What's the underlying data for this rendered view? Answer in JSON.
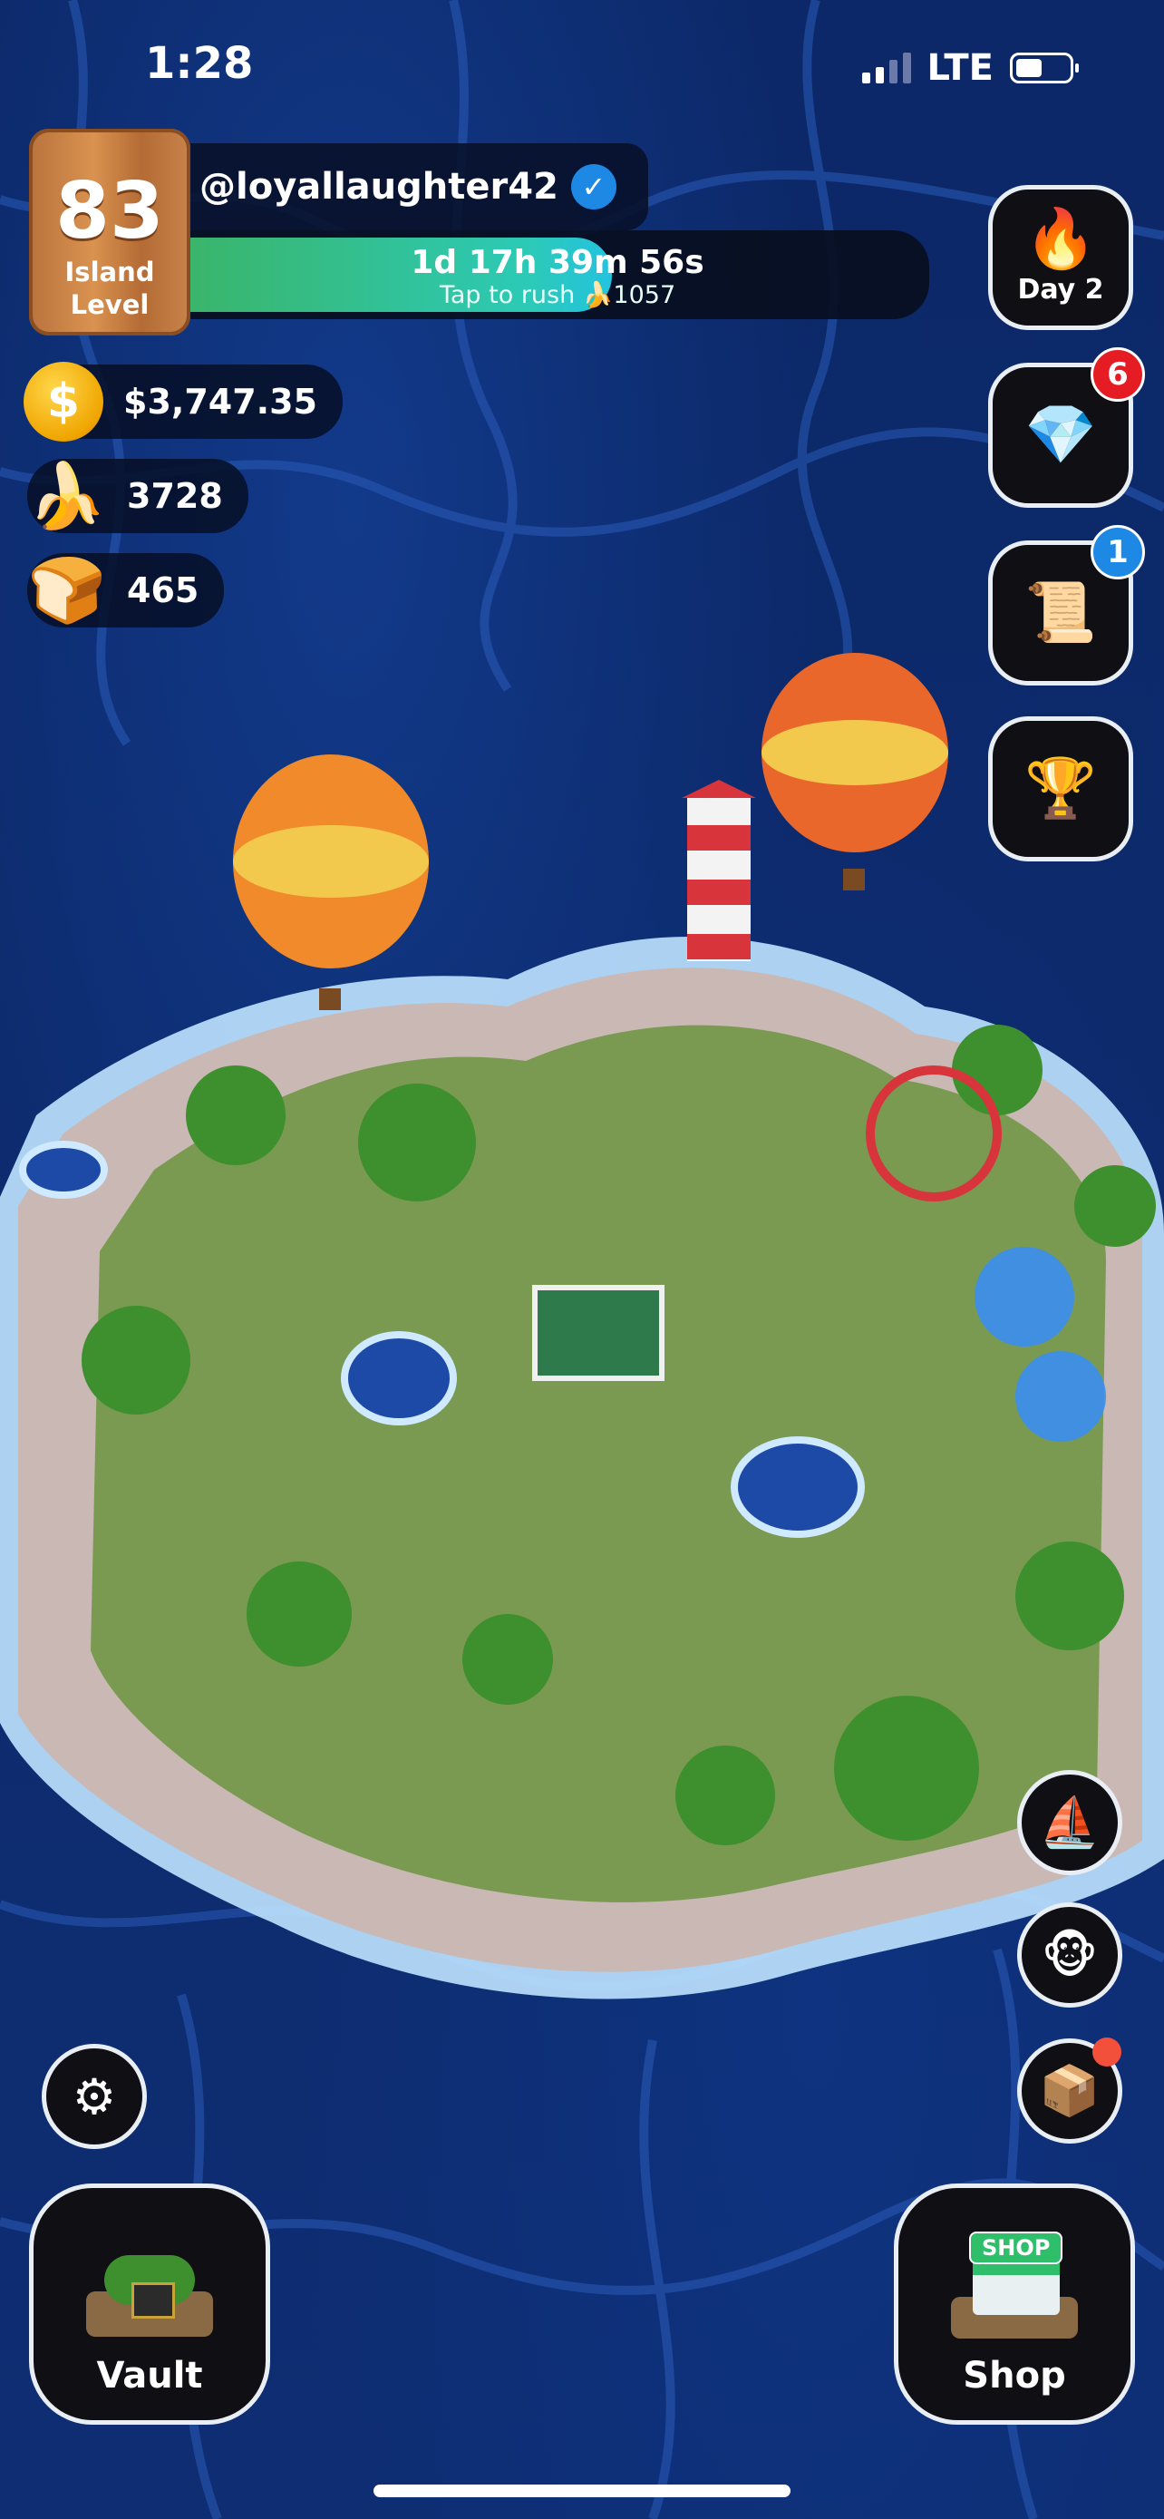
{
  "status_bar": {
    "time": "1:28",
    "network": "LTE"
  },
  "player": {
    "level": "83",
    "level_label_line1": "Island",
    "level_label_line2": "Level",
    "username": "@loyallaughter42",
    "verified_icon": "verified-check-icon"
  },
  "rush_timer": {
    "time_left": "1d 17h 39m 56s",
    "rush_text": "Tap to rush 🍌1057",
    "progress_fraction": 0.57
  },
  "currencies": {
    "cash": "$3,747.35",
    "bananas": "3728",
    "bread": "465"
  },
  "right_buttons": {
    "streak_label": "Day 2",
    "gems_badge": "6",
    "quests_badge": "1"
  },
  "bottom_buttons": {
    "vault_label": "Vault",
    "shop_label": "Shop",
    "shop_sign": "SHOP"
  },
  "colors": {
    "ocean": "#0d2a6b",
    "progress_start": "#3ab56a",
    "progress_end": "#23c3e0",
    "badge_red": "#e51c23",
    "badge_blue": "#1e88e5"
  }
}
